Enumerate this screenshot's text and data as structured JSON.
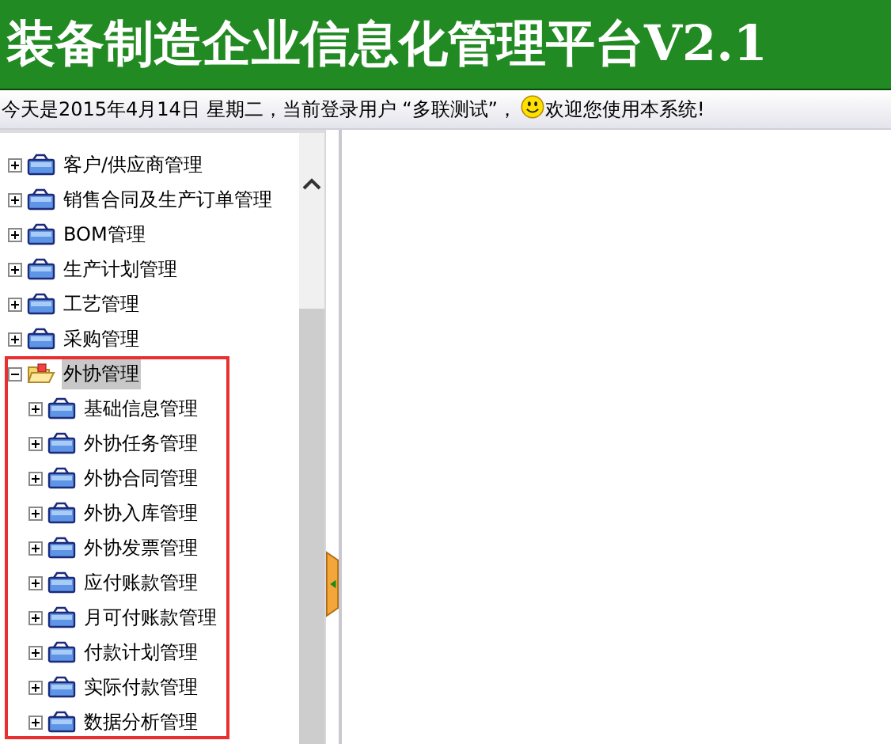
{
  "header": {
    "title": "装备制造企业信息化管理平台V2.1"
  },
  "info_bar": {
    "text_before": "今天是2015年4月14日  星期二，当前登录用户 “多联测试”，",
    "text_after": "欢迎您使用本系统!"
  },
  "tree": {
    "items": [
      {
        "label": "客户/供应商管理",
        "expanded": false,
        "selected": false
      },
      {
        "label": "销售合同及生产订单管理",
        "expanded": false,
        "selected": false
      },
      {
        "label": "BOM管理",
        "expanded": false,
        "selected": false
      },
      {
        "label": "生产计划管理",
        "expanded": false,
        "selected": false
      },
      {
        "label": "工艺管理",
        "expanded": false,
        "selected": false
      },
      {
        "label": "采购管理",
        "expanded": false,
        "selected": false
      },
      {
        "label": "外协管理",
        "expanded": true,
        "selected": true,
        "highlighted": true,
        "children": [
          {
            "label": "基础信息管理",
            "expanded": false,
            "selected": false
          },
          {
            "label": "外协任务管理",
            "expanded": false,
            "selected": false
          },
          {
            "label": "外协合同管理",
            "expanded": false,
            "selected": false
          },
          {
            "label": "外协入库管理",
            "expanded": false,
            "selected": false
          },
          {
            "label": "外协发票管理",
            "expanded": false,
            "selected": false
          },
          {
            "label": "应付账款管理",
            "expanded": false,
            "selected": false
          },
          {
            "label": "月可付账款管理",
            "expanded": false,
            "selected": false
          },
          {
            "label": "付款计划管理",
            "expanded": false,
            "selected": false
          },
          {
            "label": "实际付款管理",
            "expanded": false,
            "selected": false
          },
          {
            "label": "数据分析管理",
            "expanded": false,
            "selected": false
          }
        ]
      }
    ]
  }
}
